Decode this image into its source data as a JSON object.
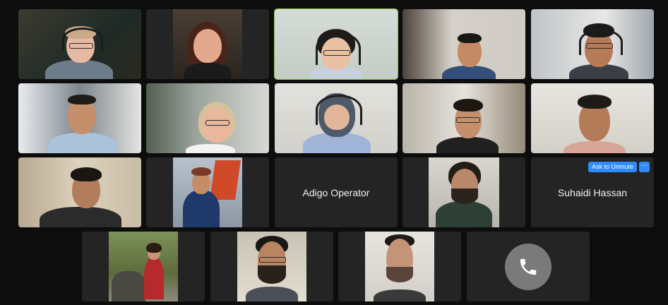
{
  "meeting": {
    "participants": [
      {
        "id": "p1",
        "name": "",
        "video": true
      },
      {
        "id": "p2",
        "name": "",
        "video": true
      },
      {
        "id": "p3",
        "name": "",
        "video": true,
        "active_speaker": true
      },
      {
        "id": "p4",
        "name": "",
        "video": true
      },
      {
        "id": "p5",
        "name": "",
        "video": true
      },
      {
        "id": "p6",
        "name": "",
        "video": true
      },
      {
        "id": "p7",
        "name": "",
        "video": true
      },
      {
        "id": "p8",
        "name": "",
        "video": true
      },
      {
        "id": "p9",
        "name": "",
        "video": true
      },
      {
        "id": "p10",
        "name": "",
        "video": true
      },
      {
        "id": "p11",
        "name": "",
        "video": true
      },
      {
        "id": "p12",
        "name": "",
        "video": true
      },
      {
        "id": "p13",
        "name": "Adigo Operator",
        "video": false
      },
      {
        "id": "p14",
        "name": "",
        "video": true
      },
      {
        "id": "p15",
        "name": "Suhaidi Hassan",
        "video": false,
        "ask_to_unmute_label": "Ask to Unmute",
        "more_label": "⋯"
      },
      {
        "id": "p16",
        "name": "",
        "video": true
      },
      {
        "id": "p17",
        "name": "",
        "video": true
      },
      {
        "id": "p18",
        "name": "",
        "video": true
      },
      {
        "id": "p19",
        "name": "",
        "video": false,
        "phone_user": true
      }
    ]
  },
  "colors": {
    "active_speaker_border": "#8bc34a",
    "tile_bg": "#242424",
    "ask_to_unmute_bg": "#2d8cff",
    "phone_circle": "#7a7a7a"
  },
  "icons": {
    "phone": "phone-icon",
    "more": "more-options-icon"
  }
}
